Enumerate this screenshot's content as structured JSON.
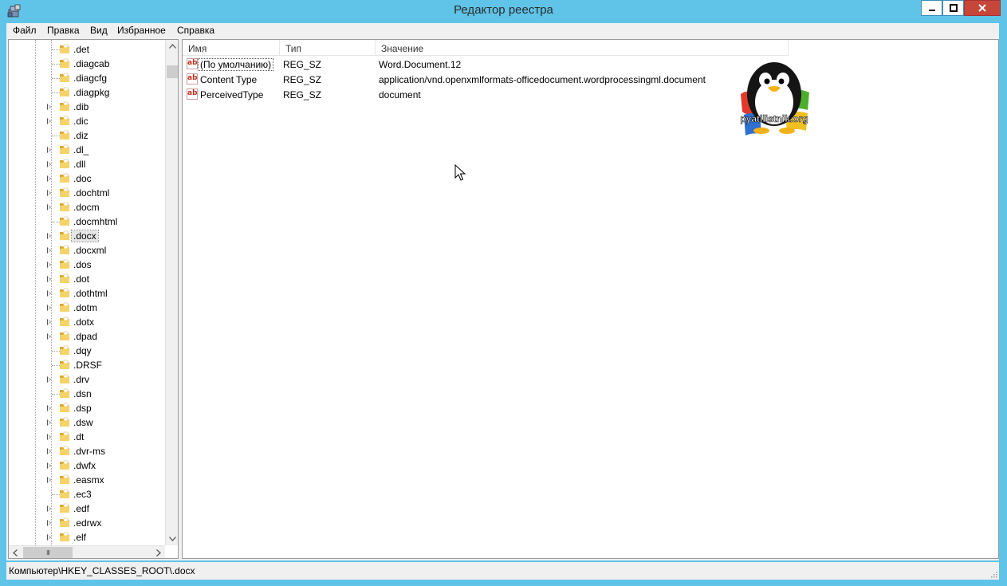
{
  "window": {
    "title": "Редактор реестра",
    "app_icon": "regedit-icon",
    "controls": [
      "minimize-icon",
      "maximize-icon",
      "close-icon"
    ]
  },
  "menu": [
    "Файл",
    "Правка",
    "Вид",
    "Избранное",
    "Справка"
  ],
  "tree": {
    "items": [
      {
        "label": ".det",
        "expandable": false
      },
      {
        "label": ".diagcab",
        "expandable": false
      },
      {
        "label": ".diagcfg",
        "expandable": false
      },
      {
        "label": ".diagpkg",
        "expandable": false
      },
      {
        "label": ".dib",
        "expandable": true
      },
      {
        "label": ".dic",
        "expandable": true
      },
      {
        "label": ".diz",
        "expandable": false
      },
      {
        "label": ".dl_",
        "expandable": true
      },
      {
        "label": ".dll",
        "expandable": true
      },
      {
        "label": ".doc",
        "expandable": true
      },
      {
        "label": ".dochtml",
        "expandable": true
      },
      {
        "label": ".docm",
        "expandable": true
      },
      {
        "label": ".docmhtml",
        "expandable": false
      },
      {
        "label": ".docx",
        "expandable": true,
        "selected": true
      },
      {
        "label": ".docxml",
        "expandable": true
      },
      {
        "label": ".dos",
        "expandable": true
      },
      {
        "label": ".dot",
        "expandable": true
      },
      {
        "label": ".dothtml",
        "expandable": true
      },
      {
        "label": ".dotm",
        "expandable": true
      },
      {
        "label": ".dotx",
        "expandable": true
      },
      {
        "label": ".dpad",
        "expandable": true
      },
      {
        "label": ".dqy",
        "expandable": false
      },
      {
        "label": ".DRSF",
        "expandable": false
      },
      {
        "label": ".drv",
        "expandable": true
      },
      {
        "label": ".dsn",
        "expandable": false
      },
      {
        "label": ".dsp",
        "expandable": true
      },
      {
        "label": ".dsw",
        "expandable": true
      },
      {
        "label": ".dt",
        "expandable": true
      },
      {
        "label": ".dvr-ms",
        "expandable": true
      },
      {
        "label": ".dwfx",
        "expandable": true
      },
      {
        "label": ".easmx",
        "expandable": true
      },
      {
        "label": ".ec3",
        "expandable": false
      },
      {
        "label": ".edf",
        "expandable": true
      },
      {
        "label": ".edrwx",
        "expandable": true
      },
      {
        "label": ".elf",
        "expandable": true
      }
    ],
    "hscroll_grip": "III"
  },
  "list": {
    "columns": [
      "Имя",
      "Тип",
      "Значение"
    ],
    "rows": [
      {
        "icon": "string-value-icon",
        "icon_text": "ab",
        "name": "(По умолчанию)",
        "type": "REG_SZ",
        "data": "Word.Document.12"
      },
      {
        "icon": "string-value-icon",
        "icon_text": "ab",
        "name": "Content Type",
        "type": "REG_SZ",
        "data": "application/vnd.openxmlformats-officedocument.wordprocessingml.document"
      },
      {
        "icon": "string-value-icon",
        "icon_text": "ab",
        "name": "PerceivedType",
        "type": "REG_SZ",
        "data": "document"
      }
    ]
  },
  "watermark": {
    "text": "pyatilistnik.org",
    "icon": "penguin-windows-logo"
  },
  "status": {
    "path": "Компьютер\\HKEY_CLASSES_ROOT\\.docx"
  },
  "colors": {
    "titlebar": "#5fc4e8",
    "close_button": "#c7463a",
    "selection": "#e6e6e6"
  }
}
